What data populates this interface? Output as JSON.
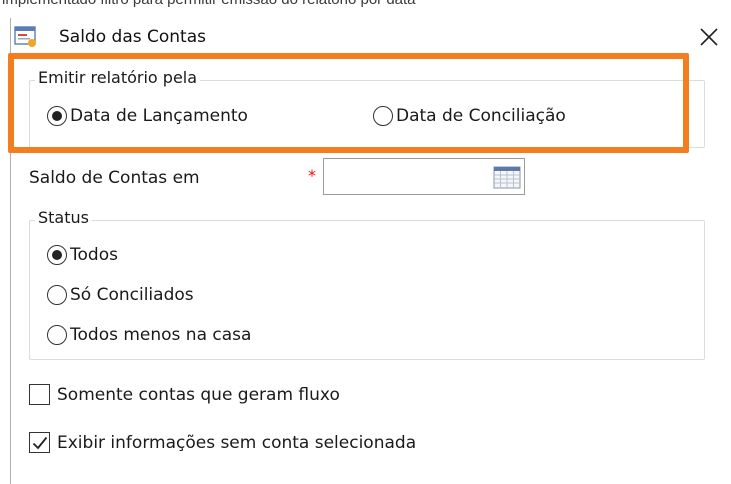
{
  "background_text": "implementado filtro para permitir emissão do relatório por data",
  "window": {
    "title": "Saldo das Contas",
    "icon": "report-window-icon",
    "close_icon": "close-icon"
  },
  "emitir_group": {
    "legend": "Emitir relatório pela",
    "options": [
      {
        "label": "Data de Lançamento",
        "selected": true
      },
      {
        "label": "Data de Conciliação",
        "selected": false
      }
    ]
  },
  "saldo_field": {
    "label": "Saldo de Contas em",
    "required_mark": "*",
    "value": "",
    "calendar_icon": "calendar-icon"
  },
  "status_group": {
    "legend": "Status",
    "options": [
      {
        "label": "Todos",
        "selected": true
      },
      {
        "label": "Só Conciliados",
        "selected": false
      },
      {
        "label": "Todos menos na casa",
        "selected": false
      }
    ]
  },
  "checkboxes": [
    {
      "label": "Somente contas que geram fluxo",
      "checked": false
    },
    {
      "label": "Exibir informações sem conta selecionada",
      "checked": true
    }
  ],
  "colors": {
    "highlight": "#f47d20",
    "required": "#e01010"
  }
}
